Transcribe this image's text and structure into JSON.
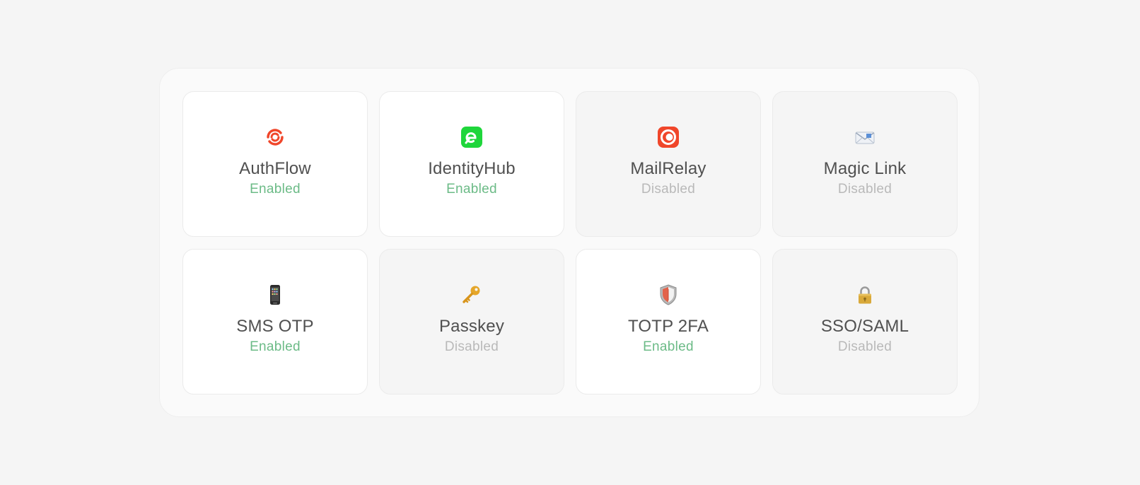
{
  "integrations": [
    {
      "name": "AuthFlow",
      "status": "Enabled",
      "enabled": true,
      "icon": "authflow-logo-icon",
      "color": "#f0462a"
    },
    {
      "name": "IdentityHub",
      "status": "Enabled",
      "enabled": true,
      "icon": "identityhub-logo-icon",
      "color": "#1fd63b"
    },
    {
      "name": "MailRelay",
      "status": "Disabled",
      "enabled": false,
      "icon": "mailrelay-logo-icon",
      "color": "#f0462a"
    },
    {
      "name": "Magic Link",
      "status": "Disabled",
      "enabled": false,
      "icon": "envelope-icon"
    },
    {
      "name": "SMS OTP",
      "status": "Enabled",
      "enabled": true,
      "icon": "mobile-phone-icon"
    },
    {
      "name": "Passkey",
      "status": "Disabled",
      "enabled": false,
      "icon": "key-icon"
    },
    {
      "name": "TOTP 2FA",
      "status": "Enabled",
      "enabled": true,
      "icon": "shield-icon"
    },
    {
      "name": "SSO/SAML",
      "status": "Disabled",
      "enabled": false,
      "icon": "lock-icon"
    }
  ],
  "colors": {
    "enabled": "#6cbb87",
    "disabled": "#b9b9b9"
  }
}
